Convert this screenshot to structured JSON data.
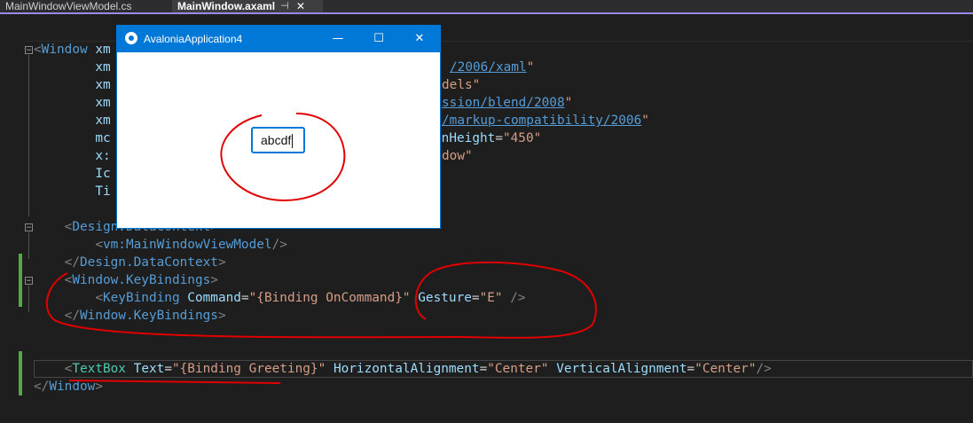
{
  "tabs": [
    {
      "label": "MainWindowViewModel.cs",
      "active": false
    },
    {
      "label": "MainWindow.axaml",
      "active": true,
      "pin_icon": "pin-icon",
      "close_icon": "close-icon"
    }
  ],
  "app_window": {
    "title": "AvaloniaApplication4",
    "textbox_value": "abcdf",
    "buttons": [
      "minimize",
      "maximize",
      "close"
    ],
    "icons": {
      "minimize": "—",
      "maximize": "☐",
      "close": "✕"
    }
  },
  "code": {
    "l1": {
      "open": "<",
      "tag": "Window",
      "rest": " xm"
    },
    "l2": {
      "prefix": "xm",
      "url": "/2006/xaml",
      "q": "\""
    },
    "l3": {
      "prefix": "xm",
      "tail": "dels\""
    },
    "l4": {
      "prefix": "xm",
      "url": "ssion/blend/2008",
      "q": "\""
    },
    "l5": {
      "prefix": "xm",
      "url": "/markup-compatibility/2006",
      "q": "\""
    },
    "l6": {
      "prefix": "mc",
      "attr": "gnHeight",
      "eq": "=",
      "val": "\"450\""
    },
    "l7": {
      "prefix": "x:",
      "tail": "dow\""
    },
    "l8": {
      "prefix": "Ic"
    },
    "l9": {
      "prefix": "Ti"
    },
    "l11": {
      "open": "<",
      "tag": "Design.DataContext",
      "close": ">"
    },
    "l12": {
      "open": "<",
      "tag": "vm:MainWindowViewModel",
      "close": "/>"
    },
    "l13": {
      "open": "</",
      "tag": "Design.DataContext",
      "close": ">"
    },
    "l14": {
      "open": "<",
      "tag": "Window.KeyBindings",
      "close": ">"
    },
    "l15": {
      "open": "<",
      "tag": "KeyBinding",
      "sp": " ",
      "attr1": "Command",
      "eq": "=",
      "val1": "\"{Binding OnCommand}\"",
      "attr2": "Gesture",
      "val2": "\"E\"",
      "close": "/>"
    },
    "l16": {
      "open": "</",
      "tag": "Window.KeyBindings",
      "close": ">"
    },
    "l18": {
      "open": "<",
      "tag": "TextBox",
      "attr1": "Text",
      "eq": "=",
      "val1": "\"{Binding Greeting}\"",
      "attr2": "HorizontalAlignment",
      "val2": "\"Center\"",
      "attr3": "VerticalAlignment",
      "val3": "\"Center\"",
      "close": "/>"
    },
    "l19": {
      "open": "</",
      "tag": "Window",
      "close": ">"
    }
  },
  "colors": {
    "editor_bg": "#1e1e1e",
    "tag": "#4ec9b0",
    "tag_blue": "#569cd6",
    "attr": "#9cdcfe",
    "string": "#d69d85",
    "punct": "#808080",
    "accent": "#0078d7",
    "annotation": "#e00000"
  }
}
